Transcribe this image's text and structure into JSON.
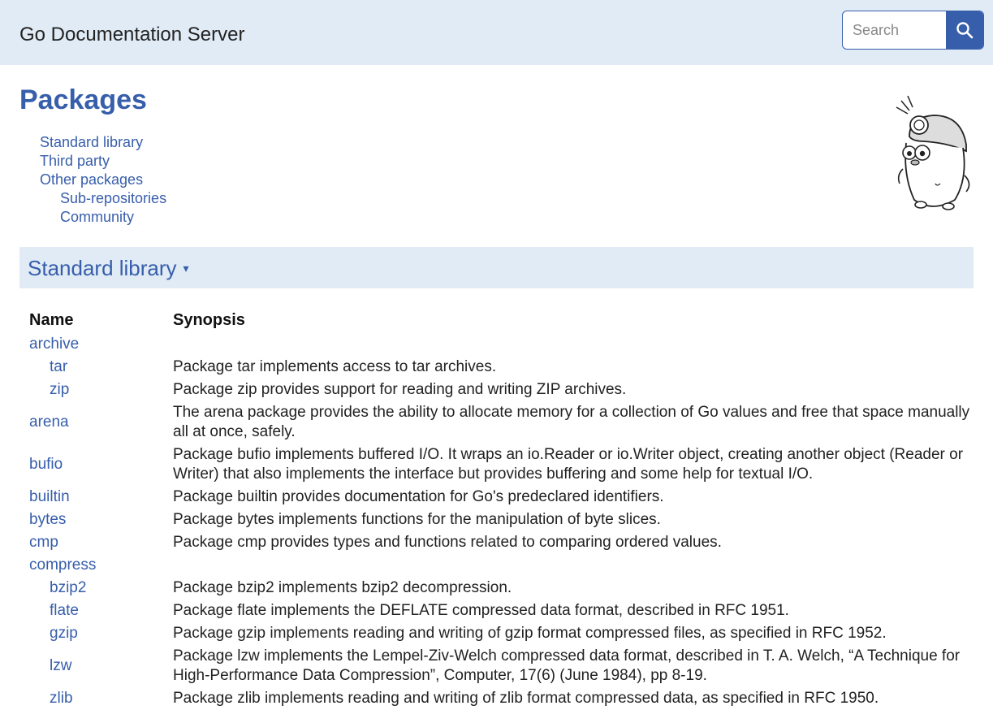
{
  "header": {
    "site_title": "Go Documentation Server",
    "search_placeholder": "Search"
  },
  "page": {
    "title": "Packages"
  },
  "toc": [
    {
      "label": "Standard library",
      "level": 0
    },
    {
      "label": "Third party",
      "level": 0
    },
    {
      "label": "Other packages",
      "level": 0
    },
    {
      "label": "Sub-repositories",
      "level": 1
    },
    {
      "label": "Community",
      "level": 1
    }
  ],
  "section": {
    "title": "Standard library",
    "caret": "▾"
  },
  "table": {
    "headers": {
      "name": "Name",
      "synopsis": "Synopsis"
    },
    "rows": [
      {
        "name": "archive",
        "sub": false,
        "synopsis": ""
      },
      {
        "name": "tar",
        "sub": true,
        "synopsis": "Package tar implements access to tar archives."
      },
      {
        "name": "zip",
        "sub": true,
        "synopsis": "Package zip provides support for reading and writing ZIP archives."
      },
      {
        "name": "arena",
        "sub": false,
        "synopsis": "The arena package provides the ability to allocate memory for a collection of Go values and free that space manually all at once, safely."
      },
      {
        "name": "bufio",
        "sub": false,
        "synopsis": "Package bufio implements buffered I/O. It wraps an io.Reader or io.Writer object, creating another object (Reader or Writer) that also implements the interface but provides buffering and some help for textual I/O."
      },
      {
        "name": "builtin",
        "sub": false,
        "synopsis": "Package builtin provides documentation for Go's predeclared identifiers."
      },
      {
        "name": "bytes",
        "sub": false,
        "synopsis": "Package bytes implements functions for the manipulation of byte slices."
      },
      {
        "name": "cmp",
        "sub": false,
        "synopsis": "Package cmp provides types and functions related to comparing ordered values."
      },
      {
        "name": "compress",
        "sub": false,
        "synopsis": ""
      },
      {
        "name": "bzip2",
        "sub": true,
        "synopsis": "Package bzip2 implements bzip2 decompression."
      },
      {
        "name": "flate",
        "sub": true,
        "synopsis": "Package flate implements the DEFLATE compressed data format, described in RFC 1951."
      },
      {
        "name": "gzip",
        "sub": true,
        "synopsis": "Package gzip implements reading and writing of gzip format compressed files, as specified in RFC 1952."
      },
      {
        "name": "lzw",
        "sub": true,
        "synopsis": "Package lzw implements the Lempel-Ziv-Welch compressed data format, described in T. A. Welch, “A Technique for High-Performance Data Compression”, Computer, 17(6) (June 1984), pp 8-19."
      },
      {
        "name": "zlib",
        "sub": true,
        "synopsis": "Package zlib implements reading and writing of zlib format compressed data, as specified in RFC 1950."
      }
    ]
  },
  "icons": {
    "search": "search-icon",
    "mascot": "gopher-icon"
  },
  "colors": {
    "accent": "#375eab",
    "header_bg": "#e0ebf5"
  }
}
